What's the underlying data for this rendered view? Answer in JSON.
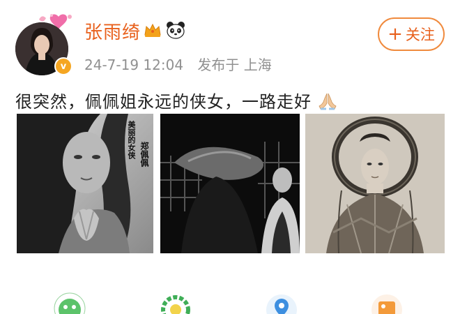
{
  "post": {
    "author": {
      "name": "张雨绮",
      "verified_mark": "v"
    },
    "author_badges": [
      "crown-badge-icon",
      "panda-badge-icon"
    ],
    "follow_button": {
      "plus": "+",
      "label": "关注"
    },
    "meta": {
      "time": "24-7-19 12:04",
      "location": "发布于 上海"
    },
    "text": "很突然，佩佩姐永远的侠女，一路走好",
    "text_emoji": "praying-hands-icon",
    "photos": [
      {
        "id": "photo-1",
        "tone": "black-and-white",
        "overlay_text": [
          "美丽的女侠",
          "郑佩佩"
        ]
      },
      {
        "id": "photo-2",
        "tone": "black-and-white"
      },
      {
        "id": "photo-3",
        "tone": "sepia"
      }
    ]
  },
  "actions_partial": [
    "green-circle-icon",
    "green-wreath-icon",
    "blue-pin-icon",
    "orange-image-icon"
  ],
  "colors": {
    "username": "#e8601c",
    "follow_border": "#f08a3d",
    "meta_gray": "#909090",
    "verified_badge": "#f5a623"
  }
}
